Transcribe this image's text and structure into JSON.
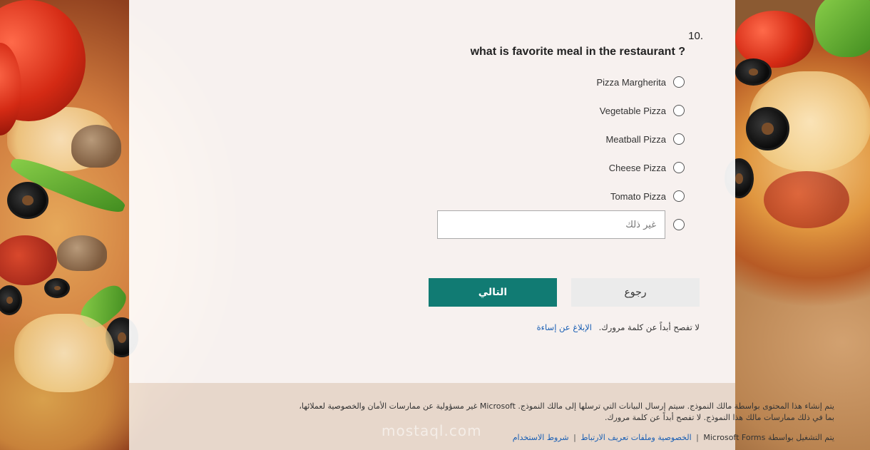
{
  "question": {
    "number": "10.",
    "title": "what is favorite meal in the restaurant ?",
    "options": [
      {
        "label": "Pizza Margherita"
      },
      {
        "label": "Vegetable Pizza"
      },
      {
        "label": "Meatball Pizza"
      },
      {
        "label": "Cheese Pizza"
      },
      {
        "label": "Tomato Pizza"
      }
    ],
    "other_placeholder": "غير ذلك",
    "other_value": ""
  },
  "buttons": {
    "back_label": "رجوع",
    "next_label": "التالي"
  },
  "password_note": {
    "text": "لا تفصح أبداً عن كلمة مرورك.",
    "report_link": "الإبلاغ عن إساءة"
  },
  "footer": {
    "disclaimer": "يتم إنشاء هذا المحتوى بواسطة مالك النموذج. سيتم إرسال البيانات التي ترسلها إلى مالك النموذج. Microsoft غير مسؤولية عن ممارسات الأمان والخصوصية لعملائها، بما في ذلك ممارسات مالك هذا النموذج. لا تفصح أبداً عن كلمة مرورك.",
    "powered_by": "يتم التشغيل بواسطة Microsoft Forms",
    "privacy_link": "الخصوصية وملفات تعريف الارتباط",
    "terms_link": "شروط الاستخدام",
    "separator": "|"
  },
  "watermark": "mostaql.com",
  "colors": {
    "accent": "#117b73",
    "link": "#1a5fb4"
  }
}
